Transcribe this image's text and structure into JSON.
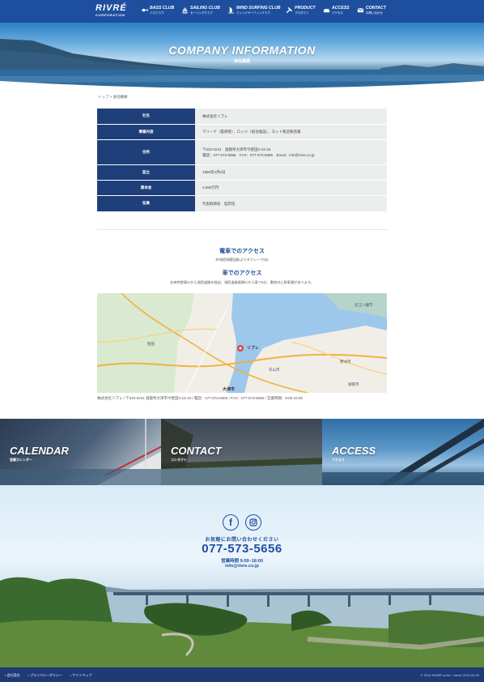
{
  "nav": {
    "logo_main": "RIVRÉ",
    "logo_sub": "CORPORATION",
    "items": [
      {
        "en": "BASS CLUB",
        "jp": "バスクラブ",
        "icon": "fish-icon"
      },
      {
        "en": "SAILING CLUB",
        "jp": "セーリングクラブ",
        "icon": "sailboat-icon"
      },
      {
        "en": "WIND SURFING CLUB",
        "jp": "ウィンドサーフィンクラブ",
        "icon": "windsurf-icon"
      },
      {
        "en": "PRODUCT",
        "jp": "プロダクト",
        "icon": "tools-icon"
      },
      {
        "en": "ACCESS",
        "jp": "アクセス",
        "icon": "car-icon"
      },
      {
        "en": "CONTACT",
        "jp": "お問い合わせ",
        "icon": "mail-icon"
      }
    ]
  },
  "hero": {
    "title": "COMPANY INFORMATION",
    "subtitle": "会社概要"
  },
  "breadcrumb": {
    "home": "トップ",
    "sep": " > ",
    "current": "会社概要"
  },
  "company": {
    "rows": [
      {
        "label": "社名",
        "value": "株式会社リブレ"
      },
      {
        "label": "事業内容",
        "value": "マリーナ（艇保管）、ロッジ（宿泊施設）、ヨット製造販売業"
      },
      {
        "label": "住所",
        "value": "〒520-0241　滋賀県大津市今堅田3-23-19",
        "value2": "電話：077-573-5656　FAX：077-573-5685　Email：info@rivre.co.jp"
      },
      {
        "label": "設立",
        "value": "1986年2月6日"
      },
      {
        "label": "資本金",
        "value": "4,590万円"
      },
      {
        "label": "役員",
        "value": "代表取締役　桂新造"
      }
    ]
  },
  "access": {
    "train_title": "電車でのアクセス",
    "train_text": "JR湖西線堅田駅よりタクシーで5分",
    "car_title": "車でのアクセス",
    "car_text": "名神京都東ICから湖西道路を経由、湖西道路真野ICから車で5分、敷地内に駐車場があります。"
  },
  "map": {
    "labels": {
      "yasu": "野洲市",
      "omihachiman": "近江八幡市",
      "rivre": "リブレ",
      "otsu": "大津市",
      "moriyama": "守山市",
      "katata": "堅田",
      "konan": "湖南市"
    }
  },
  "address_line": "株式会社リブレ / 〒520-0241 滋賀県大津市今堅田3-23-19 / 電話：077-573-5656 / FAX：077-573-5685 / 営業時間：9:00-18:00",
  "banners": [
    {
      "title": "CALENDAR",
      "sub": "営業カレンダー"
    },
    {
      "title": "CONTACT",
      "sub": "コンタクト"
    },
    {
      "title": "ACCESS",
      "sub": "アクセス"
    }
  ],
  "footer": {
    "social_facebook": "f",
    "contact_label": "お気軽にお問い合わせください",
    "phone": "077-573-5656",
    "hours": "営業時間 9:00~18:00",
    "email": "info@rivre.co.jp"
  },
  "bottom": {
    "links": [
      "会社案内",
      "プライバシーポリシー",
      "サイトマップ"
    ],
    "copyright": "© 2015 RIVRÉ co.ltd. / since 2013-02-02"
  },
  "colors": {
    "primary": "#1e4f9f",
    "navy": "#1f3a75",
    "table_head": "#1f3f7a",
    "table_cell": "#eceeee"
  }
}
